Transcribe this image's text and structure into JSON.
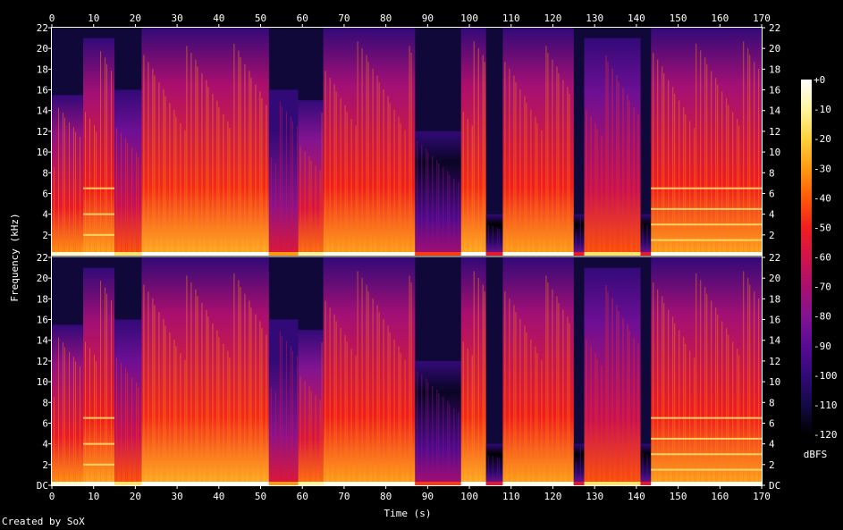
{
  "credit": "Created by SoX",
  "chart_data": {
    "type": "heatmap",
    "title": "",
    "xlabel": "Time (s)",
    "ylabel": "Frequency (kHz)",
    "xlim": [
      0,
      170
    ],
    "ylim": [
      0,
      22
    ],
    "x_ticks": [
      "0",
      "10",
      "20",
      "30",
      "40",
      "50",
      "60",
      "70",
      "80",
      "90",
      "100",
      "110",
      "120",
      "130",
      "140",
      "150",
      "160",
      "170"
    ],
    "y_ticks_lower": [
      "DC",
      "2",
      "4",
      "6",
      "8",
      "10",
      "12",
      "14",
      "16",
      "18",
      "20",
      "22"
    ],
    "y_ticks_upper": [
      "2",
      "4",
      "6",
      "8",
      "10",
      "12",
      "14",
      "16",
      "18",
      "20",
      "22"
    ],
    "channels": 2,
    "colorbar": {
      "label": "dBFS",
      "range": [
        -120,
        0
      ],
      "ticks": [
        "+0",
        "-10",
        "-20",
        "-30",
        "-40",
        "-50",
        "-60",
        "-70",
        "-80",
        "-90",
        "-100",
        "-110",
        "-120"
      ],
      "colors": [
        "#ffffff",
        "#fff5a0",
        "#ffd23c",
        "#ff9a14",
        "#ff5a08",
        "#f01e1e",
        "#d2144a",
        "#aa0f6e",
        "#821491",
        "#5a0a96",
        "#320a78",
        "#140a46",
        "#000000"
      ]
    },
    "segments": [
      {
        "start": 0,
        "end": 7.5,
        "intensity": -45,
        "top_khz": 15.5
      },
      {
        "start": 7.5,
        "end": 15,
        "intensity": -42,
        "top_khz": 21,
        "harmonics_khz": [
          2,
          4,
          6.5
        ]
      },
      {
        "start": 15,
        "end": 21.5,
        "intensity": -55,
        "top_khz": 16
      },
      {
        "start": 21.5,
        "end": 52,
        "intensity": -40,
        "top_khz": 22
      },
      {
        "start": 52,
        "end": 59,
        "intensity": -70,
        "top_khz": 16
      },
      {
        "start": 59,
        "end": 65,
        "intensity": -50,
        "top_khz": 15
      },
      {
        "start": 65,
        "end": 87,
        "intensity": -42,
        "top_khz": 22
      },
      {
        "start": 87,
        "end": 98,
        "intensity": -85,
        "top_khz": 12
      },
      {
        "start": 98,
        "end": 104,
        "intensity": -40,
        "top_khz": 22
      },
      {
        "start": 104,
        "end": 108,
        "intensity": -95,
        "top_khz": 4
      },
      {
        "start": 108,
        "end": 125,
        "intensity": -42,
        "top_khz": 22
      },
      {
        "start": 125,
        "end": 127.5,
        "intensity": -95,
        "top_khz": 4
      },
      {
        "start": 127.5,
        "end": 141,
        "intensity": -55,
        "top_khz": 21
      },
      {
        "start": 141,
        "end": 143.5,
        "intensity": -95,
        "top_khz": 4
      },
      {
        "start": 143.5,
        "end": 170,
        "intensity": -42,
        "top_khz": 22,
        "harmonics_khz": [
          1.5,
          3,
          4.5,
          6.5
        ]
      }
    ]
  }
}
